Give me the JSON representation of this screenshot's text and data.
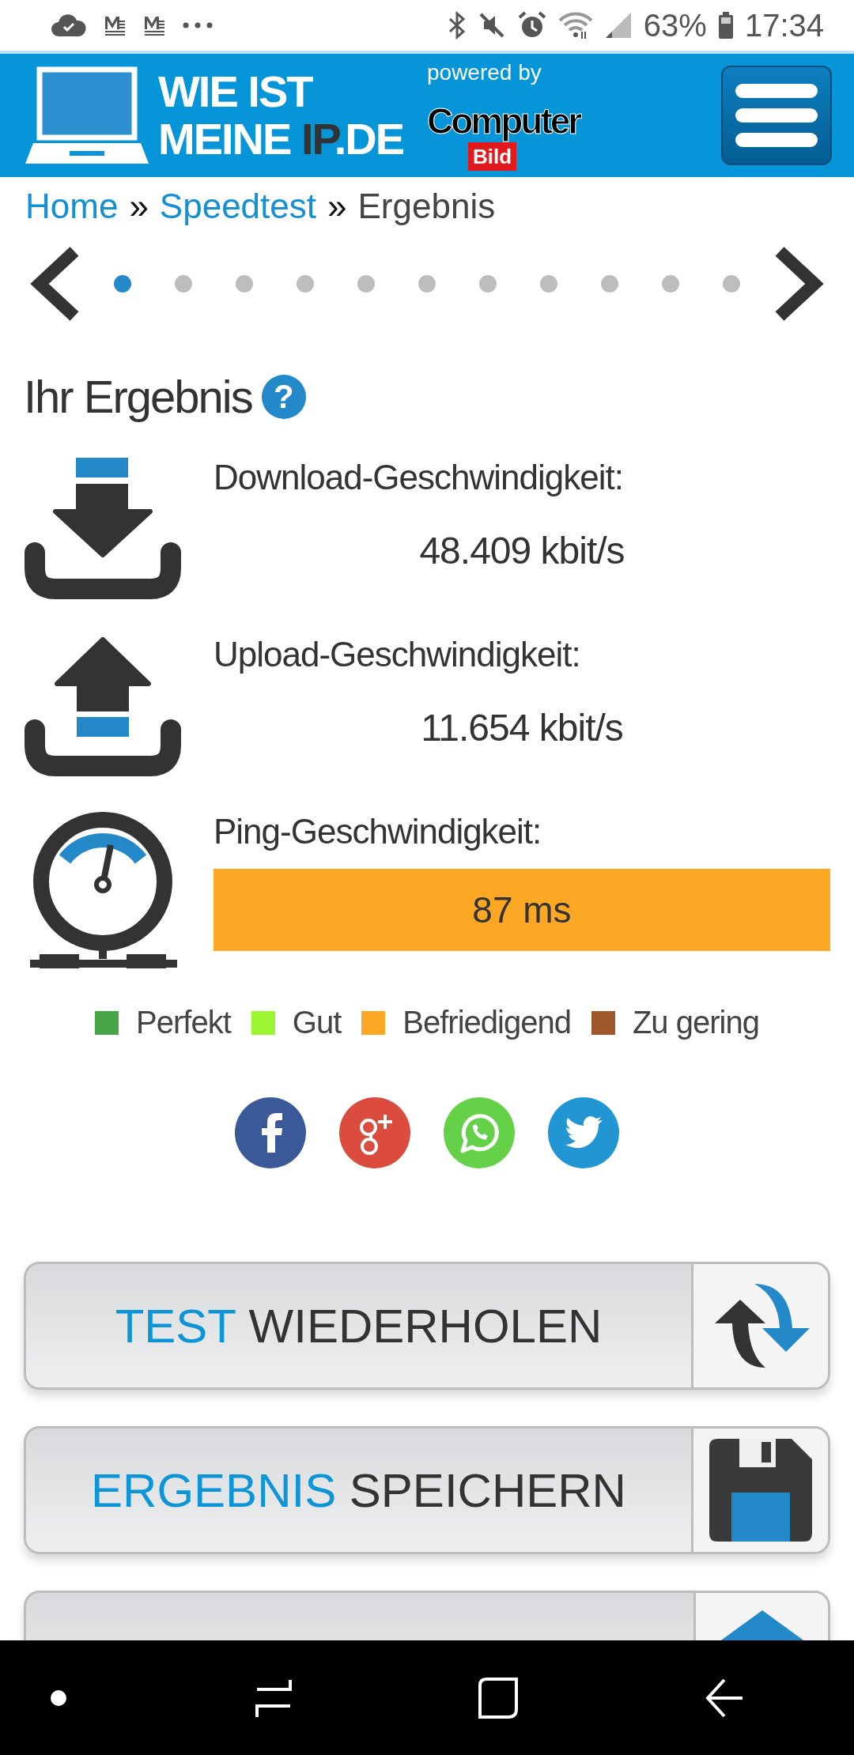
{
  "status_bar": {
    "battery": "63%",
    "time": "17:34"
  },
  "header": {
    "logo": {
      "line1": "WIE IST",
      "line2": [
        {
          "text": "MEINE ",
          "accent": false
        },
        {
          "text": "IP",
          "accent": true
        },
        {
          "text": ".DE",
          "accent": false
        }
      ]
    },
    "powered_by": "powered by",
    "sponsor": {
      "line1": "Computer",
      "line2": "Bild"
    }
  },
  "breadcrumb": [
    {
      "kind": "link",
      "text": "Home"
    },
    {
      "kind": "separator",
      "text": "»"
    },
    {
      "kind": "link",
      "text": "Speedtest"
    },
    {
      "kind": "separator",
      "text": "»"
    },
    {
      "kind": "current",
      "text": "Ergebnis"
    }
  ],
  "carousel": {
    "dots": [
      {
        "selected": true
      },
      {
        "selected": false
      },
      {
        "selected": false
      },
      {
        "selected": false
      },
      {
        "selected": false
      },
      {
        "selected": false
      },
      {
        "selected": false
      },
      {
        "selected": false
      },
      {
        "selected": false
      },
      {
        "selected": false
      },
      {
        "selected": false
      }
    ]
  },
  "result": {
    "title": "Ihr Ergebnis",
    "help": "?",
    "metrics": [
      {
        "kind": "download",
        "label": "Download-Geschwindigkeit:",
        "value": "48.409 kbit/s"
      },
      {
        "kind": "upload",
        "label": "Upload-Geschwindigkeit:",
        "value": "11.654 kbit/s"
      },
      {
        "kind": "ping",
        "label": "Ping-Geschwindigkeit:",
        "value": "87 ms",
        "color": "#fda825"
      }
    ]
  },
  "legend": [
    {
      "label": "Perfekt",
      "color": "#47a447"
    },
    {
      "label": "Gut",
      "color": "#9cf531"
    },
    {
      "label": "Befriedigend",
      "color": "#fda825"
    },
    {
      "label": "Zu gering",
      "color": "#a0572a"
    }
  ],
  "share": [
    {
      "kind": "facebook"
    },
    {
      "kind": "googleplus"
    },
    {
      "kind": "whatsapp"
    },
    {
      "kind": "twitter"
    }
  ],
  "actions": [
    {
      "kind": "repeat",
      "accent": "TEST",
      "text": "WIEDERHOLEN"
    },
    {
      "kind": "save",
      "accent": "ERGEBNIS",
      "text": "SPEICHERN"
    },
    {
      "kind": "share"
    }
  ]
}
